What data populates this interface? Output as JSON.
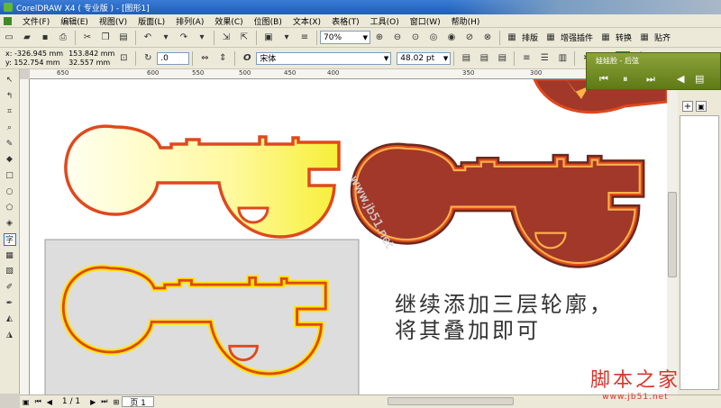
{
  "window": {
    "title": "CorelDRAW X4 ( 专业版 ) - [图形1]"
  },
  "menu": [
    "文件(F)",
    "编辑(E)",
    "视图(V)",
    "版面(L)",
    "排列(A)",
    "效果(C)",
    "位图(B)",
    "文本(X)",
    "表格(T)",
    "工具(O)",
    "窗口(W)",
    "帮助(H)"
  ],
  "toolbar": {
    "zoom": "70%",
    "plugins": [
      "排版",
      "增强插件",
      "转换",
      "贴齐"
    ]
  },
  "property_bar": {
    "x": "x: -326.945 mm",
    "y": "y: 152.754 mm",
    "width": "153.842 mm",
    "height": "32.557 mm",
    "rotation": ".0",
    "font": "宋体",
    "font_size": "48.02 pt"
  },
  "ruler": {
    "top_ticks": [
      "650",
      "600",
      "550",
      "500",
      "450",
      "400",
      "350",
      "300"
    ]
  },
  "canvas": {
    "instruction_line1": "继续添加三层轮廓，",
    "instruction_line2": "将其叠加即可",
    "diagonal_watermark": "www.jb51.net"
  },
  "player": {
    "song": "娃娃脸 - 后弦"
  },
  "status": {
    "page_count": "1 / 1",
    "page_tab": "页 1"
  },
  "watermark": {
    "main": "脚本之家",
    "sub": "www.jb51.net"
  },
  "colors": {
    "key_outline": "#e0481d",
    "key_fill_light": "#ffffc8",
    "key_fill_dark": "#a2382a",
    "key_glow": "#ffe600"
  }
}
